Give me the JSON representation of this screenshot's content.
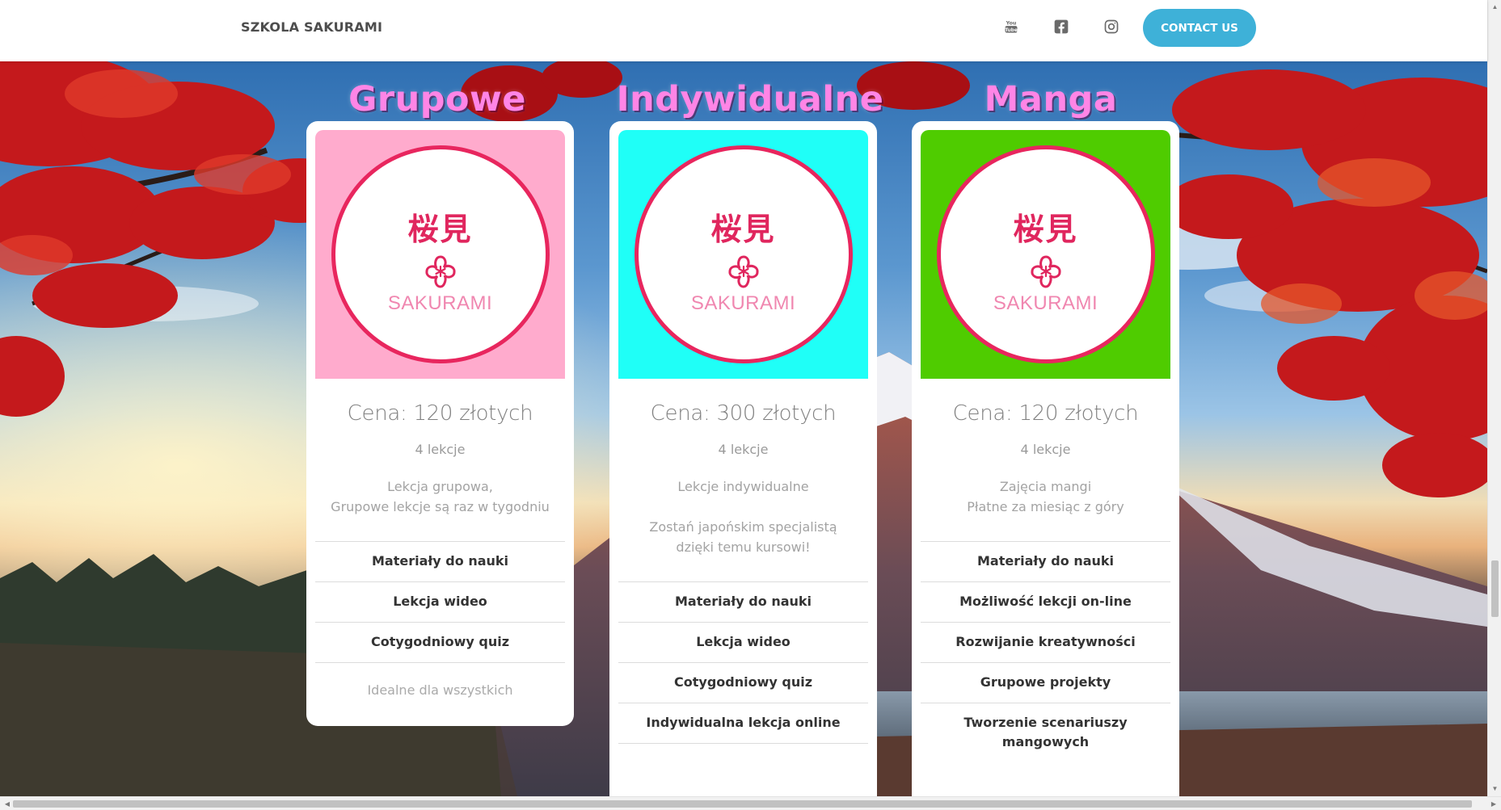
{
  "header": {
    "brand": "SZKOLA SAKURAMI",
    "social": [
      {
        "icon": "youtube-icon"
      },
      {
        "icon": "facebook-icon"
      },
      {
        "icon": "instagram-icon"
      }
    ],
    "contact_label": "CONTACT US"
  },
  "colors": {
    "accent": "#3eb1d8",
    "title_pink": "#ff85e6",
    "logo_red": "#e8265e",
    "card1_bg": "#ffabcd",
    "card2_bg": "#1ffff7",
    "card3_bg": "#4fcc00"
  },
  "logo": {
    "kanji": "桜見",
    "text": "SAKURAMI"
  },
  "plans": [
    {
      "title": "Grupowe",
      "price": "Cena: 120 złotych",
      "lessons": "4 lekcje",
      "desc1": "Lekcja grupowa,",
      "desc2": "Grupowe lekcje są raz w tygodniu",
      "f1": "Materiały do nauki",
      "f2": "Lekcja wideo",
      "f3": "Cotygodniowy quiz",
      "note": "Idealne dla wszystkich"
    },
    {
      "title": "Indywidualne",
      "price": "Cena: 300 złotych",
      "lessons": "4 lekcje",
      "desc1": "Lekcje indywidualne",
      "desc2": "Zostań japońskim specjalistą dzięki temu kursowi!",
      "f1": "Materiały do nauki",
      "f2": "Lekcja wideo",
      "f3": "Cotygodniowy quiz",
      "f4": "Indywidualna lekcja online"
    },
    {
      "title": "Manga",
      "price": "Cena: 120 złotych",
      "lessons": "4 lekcje",
      "desc1": "Zajęcia mangi",
      "desc2": "Płatne za miesiąc z góry",
      "f1": "Materiały do nauki",
      "f2": "Możliwość lekcji on-line",
      "f3": "Rozwijanie kreatywności",
      "f4": "Grupowe projekty",
      "f5": "Tworzenie scenariuszy mangowych"
    }
  ]
}
